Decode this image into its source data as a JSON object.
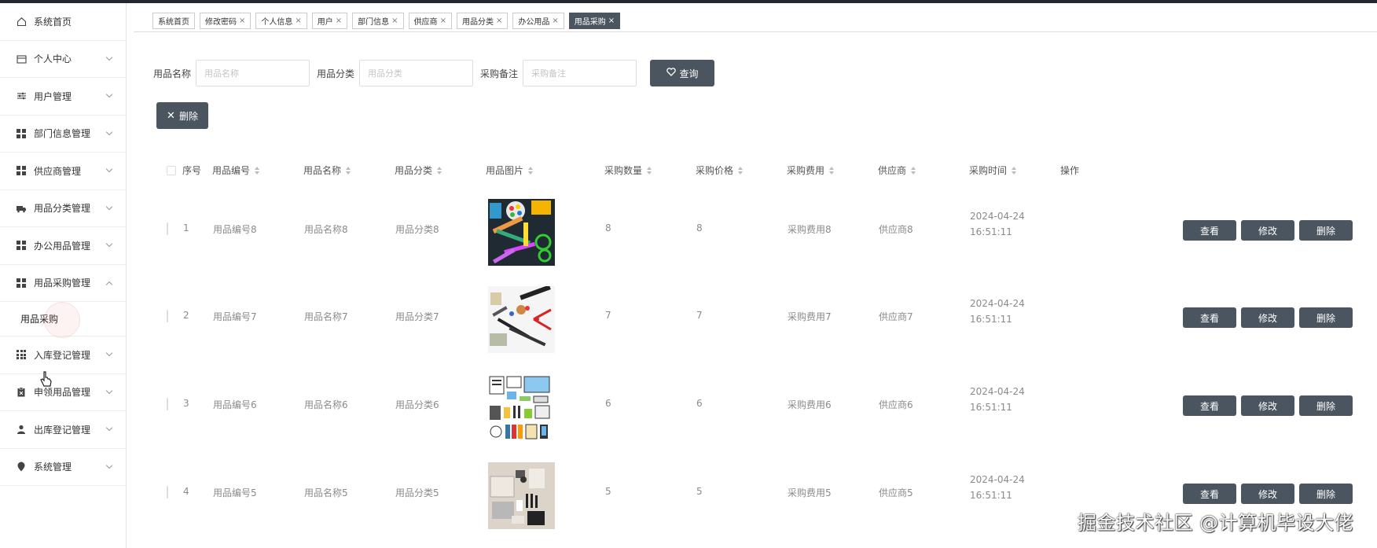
{
  "sidebar": {
    "items": [
      {
        "label": "系统首页",
        "icon": "home-icon",
        "chevron": "none"
      },
      {
        "label": "个人中心",
        "icon": "wallet-icon",
        "chevron": "down"
      },
      {
        "label": "用户管理",
        "icon": "sliders-icon",
        "chevron": "down"
      },
      {
        "label": "部门信息管理",
        "icon": "grid-icon",
        "chevron": "down"
      },
      {
        "label": "供应商管理",
        "icon": "grid-icon",
        "chevron": "down"
      },
      {
        "label": "用品分类管理",
        "icon": "truck-icon",
        "chevron": "down"
      },
      {
        "label": "办公用品管理",
        "icon": "grid-icon",
        "chevron": "down"
      },
      {
        "label": "用品采购管理",
        "icon": "grid-icon",
        "chevron": "up"
      },
      {
        "label": "入库登记管理",
        "icon": "apps-icon",
        "chevron": "down"
      },
      {
        "label": "申领用品管理",
        "icon": "clipboard-icon",
        "chevron": "down"
      },
      {
        "label": "出库登记管理",
        "icon": "user-icon",
        "chevron": "down"
      },
      {
        "label": "系统管理",
        "icon": "location-icon",
        "chevron": "down"
      }
    ],
    "sub_item": "用品采购"
  },
  "tabs": [
    {
      "label": "系统首页",
      "closable": false,
      "active": false
    },
    {
      "label": "修改密码",
      "closable": true,
      "active": false
    },
    {
      "label": "个人信息",
      "closable": true,
      "active": false
    },
    {
      "label": "用户",
      "closable": true,
      "active": false
    },
    {
      "label": "部门信息",
      "closable": true,
      "active": false
    },
    {
      "label": "供应商",
      "closable": true,
      "active": false
    },
    {
      "label": "用品分类",
      "closable": true,
      "active": false
    },
    {
      "label": "办公用品",
      "closable": true,
      "active": false
    },
    {
      "label": "用品采购",
      "closable": true,
      "active": true
    }
  ],
  "close_glyph": "×",
  "search": {
    "name_label": "用品名称",
    "name_placeholder": "用品名称",
    "category_label": "用品分类",
    "category_placeholder": "用品分类",
    "remark_label": "采购备注",
    "remark_placeholder": "采购备注",
    "query_button": "查询",
    "query_icon": "heart-icon"
  },
  "delete_button": "删除",
  "table": {
    "headers": [
      "序号",
      "用品编号",
      "用品名称",
      "用品分类",
      "用品图片",
      "采购数量",
      "采购价格",
      "采购费用",
      "供应商",
      "采购时间",
      "操作"
    ],
    "sortable": [
      false,
      true,
      true,
      true,
      true,
      true,
      true,
      true,
      true,
      true,
      false
    ],
    "rows": [
      {
        "index": "1",
        "code": "用品编号8",
        "name": "用品名称8",
        "category": "用品分类8",
        "image": "office-supplies-colorful",
        "qty": "8",
        "price": "8",
        "cost": "采购费用8",
        "supplier": "供应商8",
        "time": "2024-04-24 16:51:11"
      },
      {
        "index": "2",
        "code": "用品编号7",
        "name": "用品名称7",
        "category": "用品分类7",
        "image": "office-supplies-stationery",
        "qty": "7",
        "price": "7",
        "cost": "采购费用7",
        "supplier": "供应商7",
        "time": "2024-04-24 16:51:11"
      },
      {
        "index": "3",
        "code": "用品编号6",
        "name": "用品名称6",
        "category": "用品分类6",
        "image": "office-supplies-icons",
        "qty": "6",
        "price": "6",
        "cost": "采购费用6",
        "supplier": "供应商6",
        "time": "2024-04-24 16:51:11"
      },
      {
        "index": "4",
        "code": "用品编号5",
        "name": "用品名称5",
        "category": "用品分类5",
        "image": "office-supplies-desk",
        "qty": "5",
        "price": "5",
        "cost": "采购费用5",
        "supplier": "供应商5",
        "time": "2024-04-24 16:51:11"
      }
    ],
    "actions": [
      "查看",
      "修改",
      "删除"
    ]
  },
  "watermark": "掘金技术社区 @计算机毕设大佬",
  "colors": {
    "accent": "#4b5560",
    "topbar": "#23262e"
  }
}
